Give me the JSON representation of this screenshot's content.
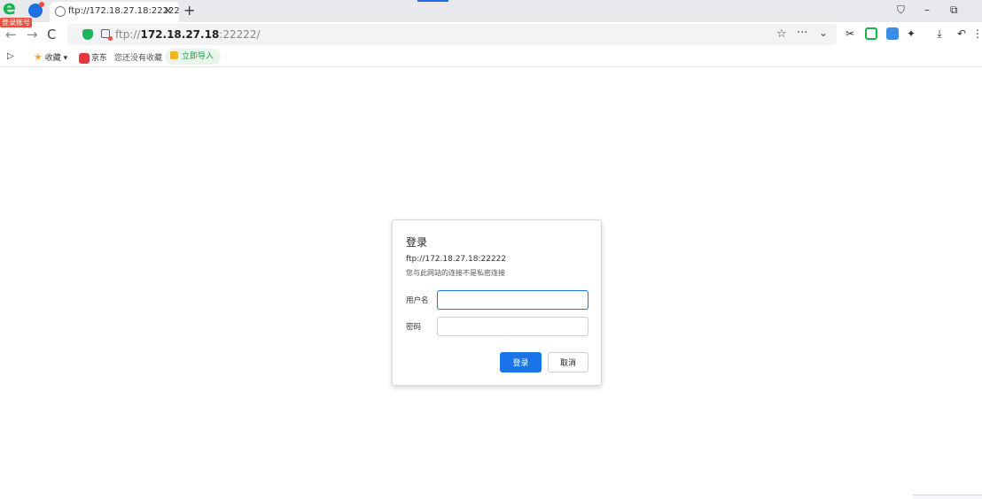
{
  "browser": {
    "login_badge": "登录账号",
    "tab": {
      "title": "ftp://172.18.27.18:22222",
      "close": "✕"
    },
    "new_tab": "+",
    "window_controls": {
      "shirt": "⛉",
      "minimize": "–",
      "restore": "⧉"
    }
  },
  "address_bar": {
    "scheme": "ftp://",
    "host": "172.18.27.18",
    "port_path": ":22222/"
  },
  "bookmarks": {
    "favorites": "收藏",
    "jd": "京东",
    "empty_note": "您还没有收藏",
    "import": "立即导入"
  },
  "dialog": {
    "title": "登录",
    "url": "ftp://172.18.27.18:22222",
    "warning": "您与此网站的连接不是私密连接",
    "username_label": "用户名",
    "username_value": "",
    "password_label": "密码",
    "password_value": "",
    "login_button": "登录",
    "cancel_button": "取消"
  },
  "colors": {
    "accent": "#1a73e8",
    "brand_green": "#19b24b",
    "warning_red": "#ef4b3f"
  }
}
